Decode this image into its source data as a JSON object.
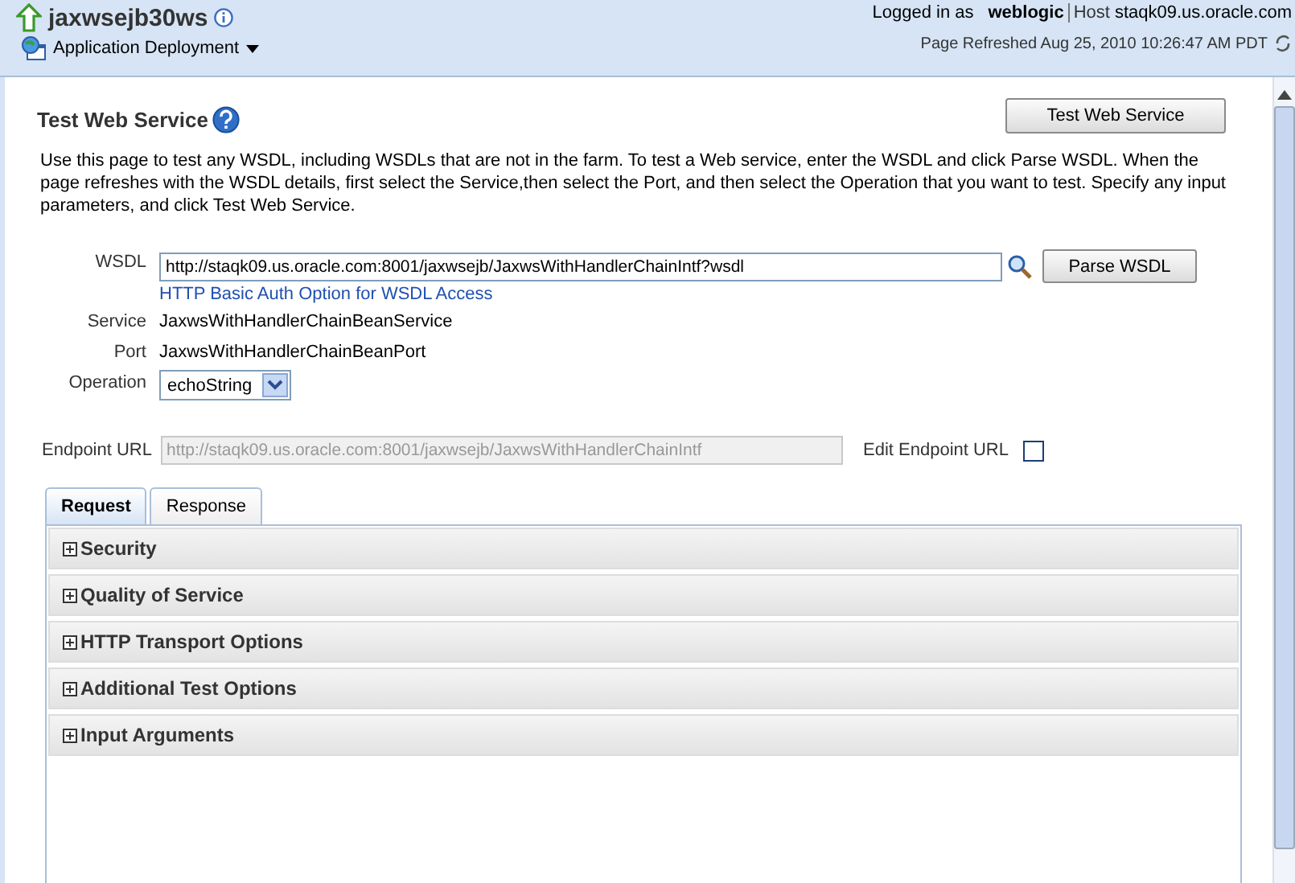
{
  "header": {
    "title": "jaxwsejb30ws",
    "menu": "Application Deployment",
    "logged_in_label": "Logged in as",
    "user": "weblogic",
    "host_label": "Host",
    "host": "staqk09.us.oracle.com",
    "refreshed": "Page Refreshed Aug 25, 2010 10:26:47 AM PDT"
  },
  "page": {
    "title": "Test Web Service",
    "top_button": "Test Web Service",
    "description": "Use this page to test any WSDL, including WSDLs that are not in the farm. To test a Web service, enter the WSDL and click Parse WSDL. When the page refreshes with the WSDL details, first select the Service,then select the Port, and then select the Operation that you want to test. Specify any input parameters, and click Test Web Service."
  },
  "form": {
    "wsdl_label": "WSDL",
    "wsdl_value": "http://staqk09.us.oracle.com:8001/jaxwsejb/JaxwsWithHandlerChainIntf?wsdl",
    "parse_button": "Parse WSDL",
    "auth_link": "HTTP Basic Auth Option for WSDL Access",
    "service_label": "Service",
    "service": "JaxwsWithHandlerChainBeanService",
    "port_label": "Port",
    "port": "JaxwsWithHandlerChainBeanPort",
    "operation_label": "Operation",
    "operation": "echoString",
    "endpoint_label": "Endpoint URL",
    "endpoint_value": "http://staqk09.us.oracle.com:8001/jaxwsejb/JaxwsWithHandlerChainIntf",
    "endpoint_disabled": true,
    "edit_endpoint_label": "Edit Endpoint URL",
    "edit_endpoint_checked": false
  },
  "tabs": [
    {
      "label": "Request",
      "selected": true
    },
    {
      "label": "Response",
      "selected": false
    }
  ],
  "sections": [
    {
      "label": "Security",
      "expanded": false
    },
    {
      "label": "Quality of Service",
      "expanded": false
    },
    {
      "label": "HTTP Transport Options",
      "expanded": false
    },
    {
      "label": "Additional Test Options",
      "expanded": false
    },
    {
      "label": "Input Arguments",
      "expanded": false
    }
  ]
}
